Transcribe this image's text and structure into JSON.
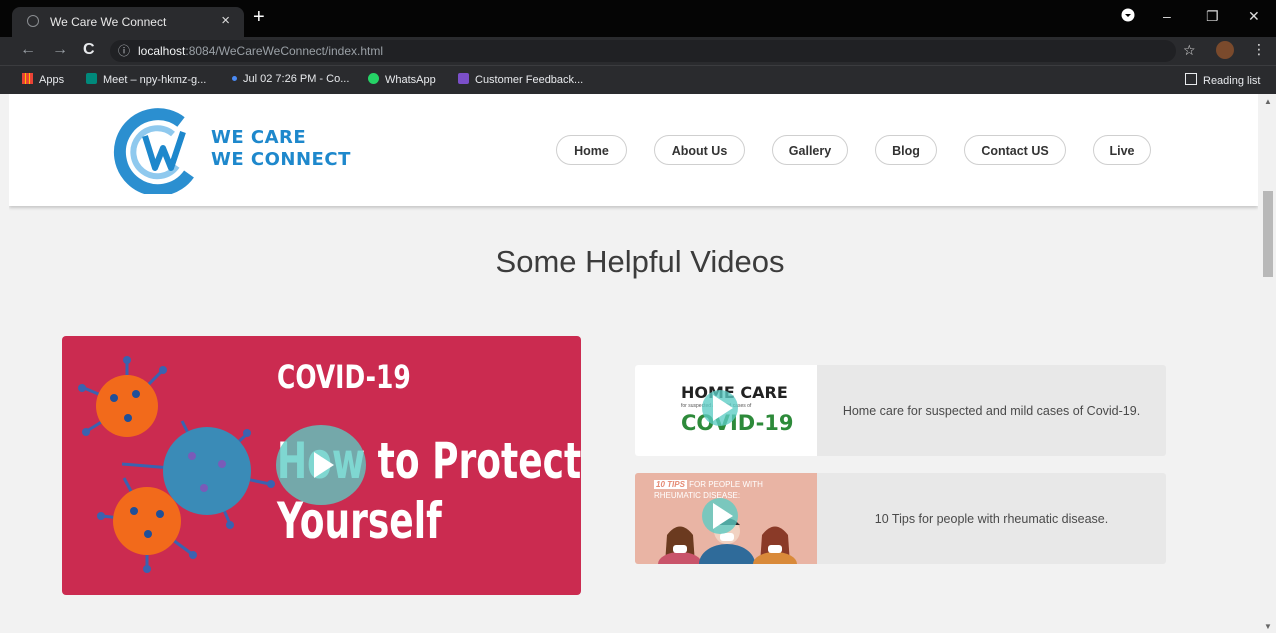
{
  "browser": {
    "tab_title": "We Care We Connect",
    "tab_close": "×",
    "new_tab": "+",
    "url_host": "localhost",
    "url_path": ":8084/WeCareWeConnect/index.html",
    "bookmarks": [
      "Apps",
      "Meet – npy-hkmz-g...",
      "Jul 02 7:26 PM - Co...",
      "WhatsApp",
      "Customer Feedback..."
    ],
    "reading_list": "Reading list"
  },
  "site": {
    "brand_line1": "WE CARE",
    "brand_line2": "WE CONNECT",
    "nav": [
      "Home",
      "About Us",
      "Gallery",
      "Blog",
      "Contact US",
      "Live"
    ]
  },
  "main": {
    "section_title": "Some Helpful Videos",
    "featured_video": {
      "title_line1": "COVID-19",
      "title_line2": "How to Protect",
      "title_line3": "Yourself"
    },
    "videos": [
      {
        "thumb_line1": "HOME CARE",
        "thumb_line2": "for suspected and mild cases of",
        "thumb_line3": "COVID-19",
        "description": "Home care for suspected and mild cases of Covid-19."
      },
      {
        "thumb_badge": "10 TIPS",
        "thumb_line1": "FOR PEOPLE WITH",
        "thumb_line2": "RHEUMATIC DISEASE:",
        "description": "10 Tips for people with rheumatic disease."
      }
    ]
  },
  "colors": {
    "brand": "#1e88cc",
    "video_bg": "#cb2b50",
    "virus_orange": "#f26a1b",
    "virus_blue": "#3a8bb7",
    "play_teal": "#5bccc4"
  }
}
